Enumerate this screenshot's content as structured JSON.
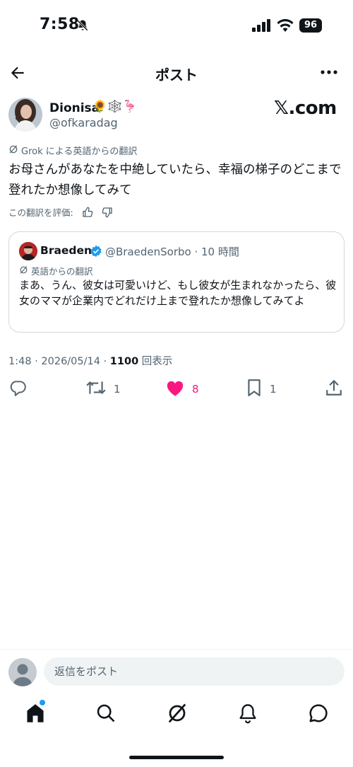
{
  "status_bar": {
    "time": "7:58",
    "battery": "96"
  },
  "header": {
    "title": "ポスト"
  },
  "author": {
    "name": "Dionisa",
    "emoji": "🌻🕸️🦩",
    "handle": "@ofkaradag"
  },
  "watermark": "𝕏.com",
  "post": {
    "translation_note": "Grok による英語からの翻訳",
    "text": "お母さんがあなたを中絶していたら、幸福の梯子のどこまで登れたか想像してみて",
    "rate_label": "この翻訳を評価:"
  },
  "quote": {
    "name": "Braeden",
    "handle_time": "@BraedenSorbo · 10 時間",
    "translation_note": "英語からの翻訳",
    "text": "まあ、うん、彼女は可愛いけど、もし彼女が生まれなかったら、彼女のママが企業内でどれだけ上まで登れたか想像してみてよ"
  },
  "meta": {
    "time_date": "1:48 · 2026/05/14 · ",
    "views": "1100",
    "views_label": " 回表示"
  },
  "actions": {
    "reposts": "1",
    "likes": "8",
    "bookmarks": "1"
  },
  "reply": {
    "placeholder": "返信をポスト"
  },
  "colors": {
    "like": "#f91880",
    "accent": "#1d9bf0",
    "text": "#0f1419",
    "muted": "#536471"
  }
}
